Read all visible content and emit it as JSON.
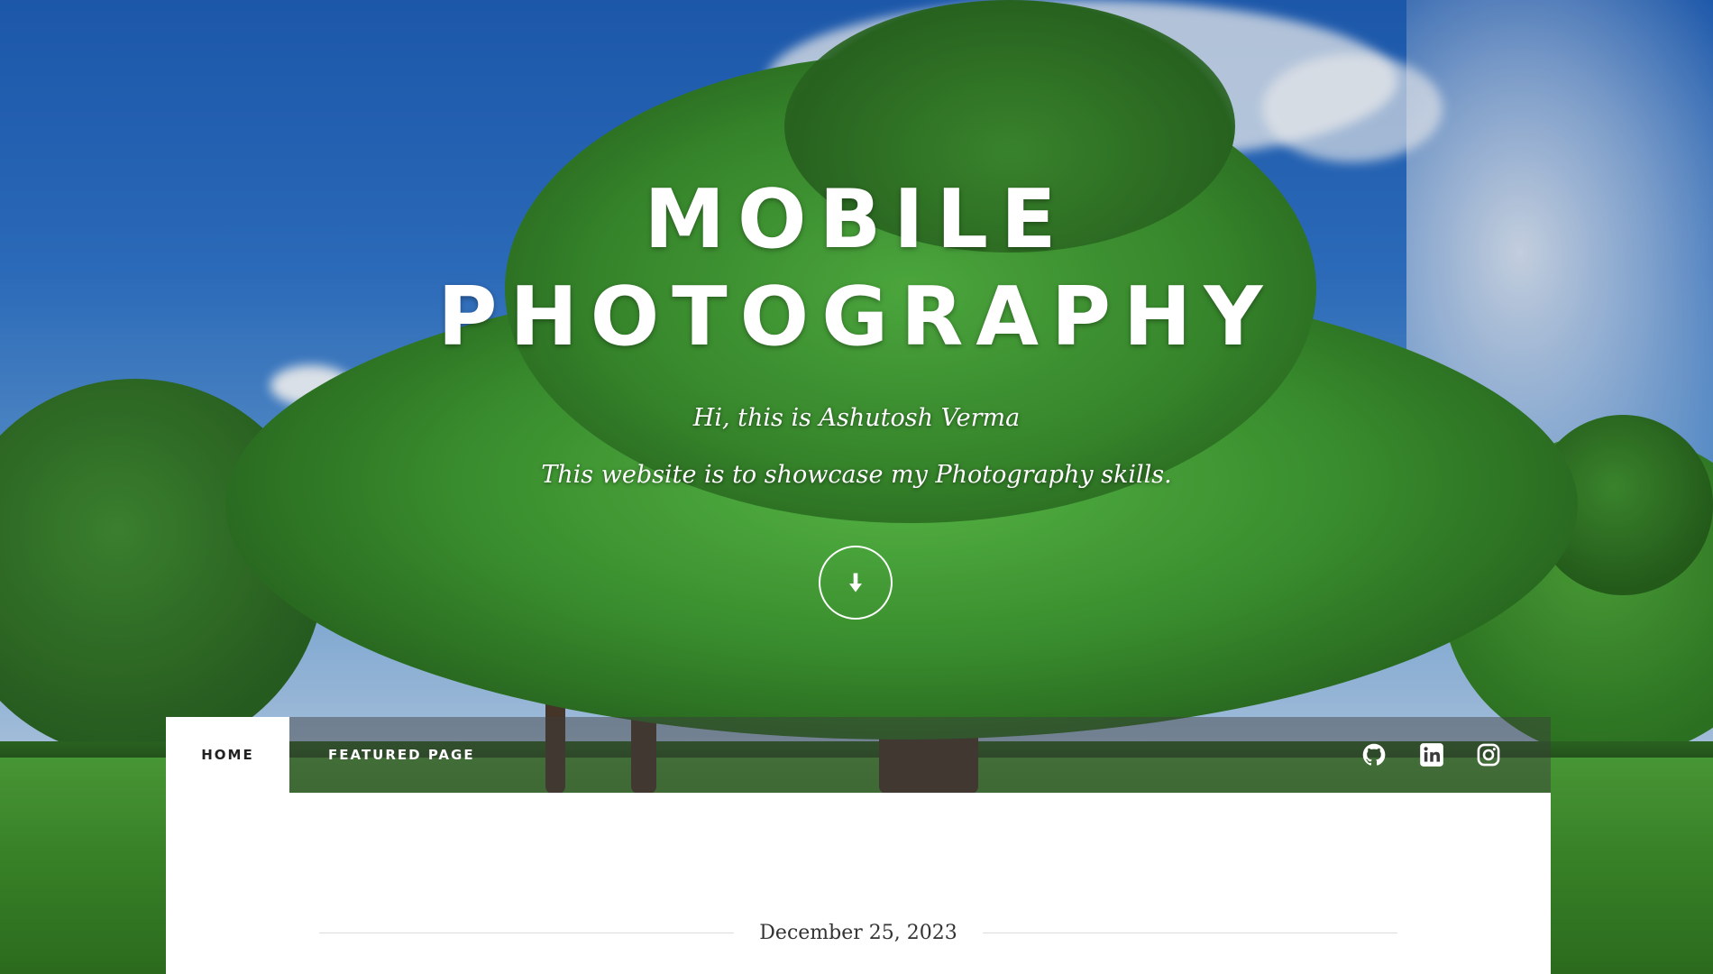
{
  "hero": {
    "title_line1": "MOBILE",
    "title_line2": "PHOTOGRAPHY",
    "greeting": "Hi, this is Ashutosh Verma",
    "tagline": "This website is to showcase my Photography skills."
  },
  "nav": {
    "items": [
      {
        "label": "HOME",
        "active": true
      },
      {
        "label": "FEATURED PAGE",
        "active": false
      }
    ],
    "social": [
      "github-icon",
      "linkedin-icon",
      "instagram-icon"
    ]
  },
  "post": {
    "date": "December 25, 2023"
  },
  "colors": {
    "nav_overlay": "#3c3c3c",
    "content_bg": "#ffffff",
    "text_dark": "#222222"
  }
}
